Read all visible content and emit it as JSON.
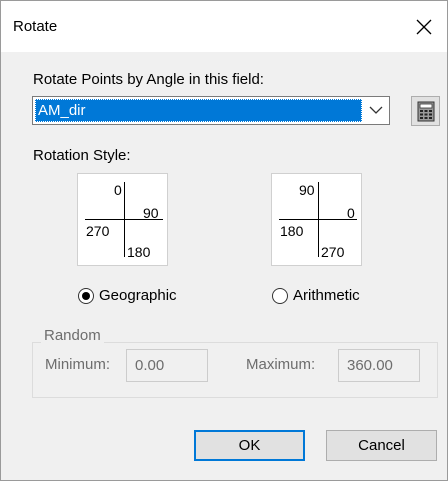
{
  "window": {
    "title": "Rotate",
    "close_icon": "close-icon"
  },
  "field": {
    "label": "Rotate Points by Angle in this field:",
    "value": "AM_dir"
  },
  "rotation_style": {
    "label": "Rotation Style:",
    "geographic": {
      "label": "Geographic",
      "selected": true,
      "top": "0",
      "right": "90",
      "left": "270",
      "bottom": "180"
    },
    "arithmetic": {
      "label": "Arithmetic",
      "selected": false,
      "top": "90",
      "right": "0",
      "left": "180",
      "bottom": "270"
    }
  },
  "random": {
    "label": "Random",
    "minimum_label": "Minimum:",
    "minimum_value": "0.00",
    "maximum_label": "Maximum:",
    "maximum_value": "360.00"
  },
  "buttons": {
    "ok": "OK",
    "cancel": "Cancel"
  },
  "colors": {
    "selection": "#0078d7",
    "dialog_bg": "#f0f0f0"
  }
}
